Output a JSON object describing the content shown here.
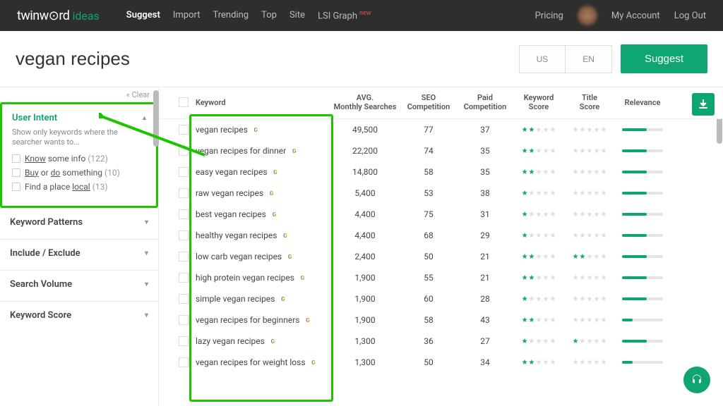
{
  "header": {
    "logo_main": "twinw⊙rd",
    "logo_ideas": "ideas",
    "nav": [
      "Suggest",
      "Import",
      "Trending",
      "Top",
      "Site",
      "LSI Graph"
    ],
    "nav_badge": "new",
    "active_nav": "Suggest",
    "right": [
      "Pricing",
      "My Account",
      "Log Out"
    ]
  },
  "search": {
    "value": "vegan recipes",
    "locale_country": "US",
    "locale_lang": "EN",
    "suggest_btn": "Suggest"
  },
  "sidebar": {
    "clear": "« Clear",
    "user_intent": {
      "title": "User Intent",
      "desc": "Show only keywords where the searcher wants to...",
      "opts": [
        {
          "pre": "",
          "u": "Know",
          "post": " some info",
          "count": "(122)"
        },
        {
          "pre": "",
          "u": "Buy",
          "mid": " or ",
          "u2": "do",
          "post": " something",
          "count": "(10)"
        },
        {
          "pre": "Find a place ",
          "u": "local",
          "post": "",
          "count": "(13)"
        }
      ]
    },
    "groups": [
      "Keyword Patterns",
      "Include / Exclude",
      "Search Volume",
      "Keyword Score"
    ]
  },
  "table": {
    "columns": [
      "Keyword",
      "AVG.\nMonthly Searches",
      "SEO\nCompetition",
      "Paid\nCompetition",
      "Keyword\nScore",
      "Title\nScore",
      "Relevance"
    ],
    "rows": [
      {
        "kw": "vegan recipes",
        "avg": "49,500",
        "seo": "77",
        "paid": "37",
        "ks": 2,
        "ts": 0,
        "rel": 60
      },
      {
        "kw": "vegan recipes for dinner",
        "avg": "22,200",
        "seo": "74",
        "paid": "35",
        "ks": 2,
        "ts": 0,
        "rel": 60
      },
      {
        "kw": "easy vegan recipes",
        "avg": "14,800",
        "seo": "58",
        "paid": "35",
        "ks": 2,
        "ts": 0,
        "rel": 60
      },
      {
        "kw": "raw vegan recipes",
        "avg": "5,400",
        "seo": "53",
        "paid": "38",
        "ks": 1,
        "ts": 0,
        "rel": 60
      },
      {
        "kw": "best vegan recipes",
        "avg": "4,400",
        "seo": "75",
        "paid": "31",
        "ks": 1,
        "ts": 0,
        "rel": 60
      },
      {
        "kw": "healthy vegan recipes",
        "avg": "4,400",
        "seo": "68",
        "paid": "29",
        "ks": 1,
        "ts": 0,
        "rel": 60
      },
      {
        "kw": "low carb vegan recipes",
        "avg": "2,400",
        "seo": "50",
        "paid": "21",
        "ks": 2,
        "ts": 2,
        "rel": 60
      },
      {
        "kw": "high protein vegan recipes",
        "avg": "1,900",
        "seo": "55",
        "paid": "21",
        "ks": 2,
        "ts": 0,
        "rel": 60
      },
      {
        "kw": "simple vegan recipes",
        "avg": "1,900",
        "seo": "60",
        "paid": "28",
        "ks": 1,
        "ts": 0,
        "rel": 60
      },
      {
        "kw": "vegan recipes for beginners",
        "avg": "1,900",
        "seo": "58",
        "paid": "43",
        "ks": 2,
        "ts": 0,
        "rel": 25
      },
      {
        "kw": "lazy vegan recipes",
        "avg": "1,300",
        "seo": "36",
        "paid": "27",
        "ks": 1,
        "ts": 1,
        "rel": 60
      },
      {
        "kw": "vegan recipes for weight loss",
        "avg": "1,300",
        "seo": "50",
        "paid": "34",
        "ks": 2,
        "ts": 0,
        "rel": 25
      }
    ]
  }
}
